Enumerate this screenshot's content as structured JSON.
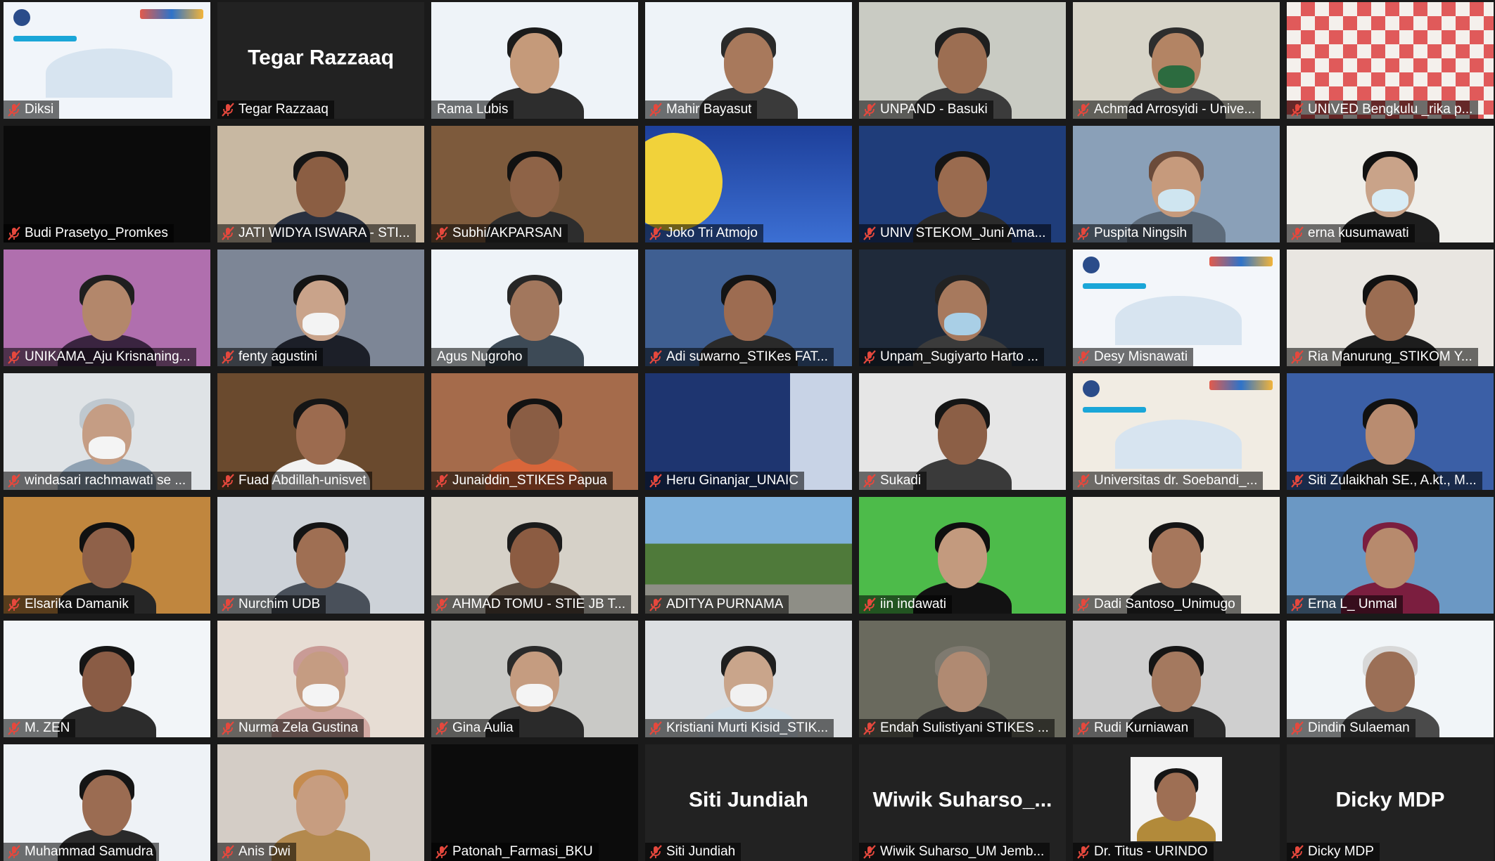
{
  "meeting": {
    "participants": [
      {
        "name": "Diksi",
        "muted": true,
        "view": "banner",
        "bg": "#f1f5fa"
      },
      {
        "name": "Tegar Razzaaq",
        "muted": true,
        "view": "name-only",
        "big_name": "Tegar Razzaaq",
        "bg": "#222222"
      },
      {
        "name": "Rama Lubis",
        "muted": false,
        "view": "camera",
        "active_speaker": true,
        "bg": "#eef3f8",
        "skin": "#c59a7a",
        "shirt": "#2d2d2d",
        "hair": "#1b1b1b"
      },
      {
        "name": "Mahir Bayasut",
        "muted": true,
        "view": "camera",
        "bg": "#eef3f8",
        "skin": "#a8795c",
        "shirt": "#3a3a3a",
        "hair": "#2a2a2a"
      },
      {
        "name": "UNPAND - Basuki",
        "muted": true,
        "view": "camera",
        "bg": "#c9cbc3",
        "skin": "#9c6e52",
        "shirt": "#3b3b3b",
        "hair": "#1f1f1f"
      },
      {
        "name": "Achmad Arrosyidi - Unive...",
        "muted": true,
        "view": "camera",
        "bg": "#d7d4c8",
        "skin": "#b38464",
        "shirt": "#4b4b4b",
        "hair": "#2d2d2d",
        "mask": "#2c6b3f"
      },
      {
        "name": "UNIVED Bengkulu _rika p...",
        "muted": true,
        "view": "pattern",
        "bg": "#f2f2f2"
      },
      {
        "name": "Budi Prasetyo_Promkes",
        "muted": true,
        "view": "dark",
        "bg": "#0b0b0b"
      },
      {
        "name": "JATI WIDYA ISWARA - STI...",
        "muted": true,
        "view": "camera",
        "bg": "#c8b8a2",
        "skin": "#8b5e43",
        "shirt": "#2a3140",
        "hair": "#151515"
      },
      {
        "name": "Subhi/AKPARSAN",
        "muted": true,
        "view": "camera",
        "bg": "#7d5a3c",
        "skin": "#8e6347",
        "shirt": "#2d2d2d",
        "hair": "#111111"
      },
      {
        "name": "Joko Tri Atmojo",
        "muted": true,
        "view": "poster",
        "bg": "#2b59b5"
      },
      {
        "name": "UNIV STEKOM_Juni Ama...",
        "muted": true,
        "view": "camera",
        "bg": "#1f3d7a",
        "skin": "#9a6b4f",
        "shirt": "#2b2b2b",
        "hair": "#151515"
      },
      {
        "name": "Puspita Ningsih",
        "muted": true,
        "view": "camera",
        "bg": "#8aa0b8",
        "skin": "#c69a7c",
        "shirt": "#5d6b7a",
        "hair": "#6b4b3a",
        "mask": "#cfe5f0"
      },
      {
        "name": "erna kusumawati",
        "muted": true,
        "view": "camera",
        "bg": "#efeeea",
        "skin": "#c9a389",
        "shirt": "#1d1d1d",
        "hair": "#111111",
        "mask": "#d9ecf5"
      },
      {
        "name": "UNIKAMA_Aju Krisnaning...",
        "muted": true,
        "view": "camera",
        "bg": "#b06fae",
        "skin": "#b3876b",
        "shirt": "#3a2440",
        "hair": "#1f1f1f"
      },
      {
        "name": "fenty agustini",
        "muted": true,
        "view": "camera",
        "bg": "#7d8696",
        "skin": "#c9a38a",
        "shirt": "#1c1f28",
        "hair": "#141414",
        "mask": "#f3f3f3"
      },
      {
        "name": "Agus Nugroho",
        "muted": false,
        "view": "camera",
        "bg": "#eef3f8",
        "skin": "#a2775d",
        "shirt": "#3d4a56",
        "hair": "#262626"
      },
      {
        "name": "Adi suwarno_STIKes FAT...",
        "muted": true,
        "view": "camera",
        "bg": "#3f5f92",
        "skin": "#9d6c51",
        "shirt": "#2a2a2a",
        "hair": "#141414"
      },
      {
        "name": "Unpam_Sugiyarto Harto ...",
        "muted": true,
        "view": "camera",
        "bg": "#1f2a3a",
        "skin": "#a7795d",
        "shirt": "#3b3b3b",
        "hair": "#222222",
        "mask": "#a9cfe6"
      },
      {
        "name": "Desy Misnawati",
        "muted": true,
        "view": "banner2",
        "bg": "#f3f6fa"
      },
      {
        "name": "Ria Manurung_STIKOM Y...",
        "muted": true,
        "view": "camera",
        "bg": "#e9e6e1",
        "skin": "#9b6d52",
        "shirt": "#1d1d1d",
        "hair": "#111111"
      },
      {
        "name": "windasari rachmawati se ...",
        "muted": true,
        "view": "camera",
        "bg": "#dfe3e6",
        "skin": "#c59d84",
        "shirt": "#8fa1b2",
        "hair": "#bfc8cf",
        "mask": "#f4f4f4"
      },
      {
        "name": "Fuad Abdillah-unisvet",
        "muted": true,
        "view": "camera",
        "bg": "#6a4a2e",
        "skin": "#9c6b4f",
        "shirt": "#f2f2f2",
        "hair": "#151515"
      },
      {
        "name": "Junaiddin_STIKES Papua",
        "muted": true,
        "view": "camera",
        "bg": "#a56b4b",
        "skin": "#8a5d44",
        "shirt": "#d9663a",
        "hair": "#121212"
      },
      {
        "name": "Heru Ginanjar_UNAIC",
        "muted": true,
        "view": "poster2",
        "bg": "#233b7a"
      },
      {
        "name": "Sukadi",
        "muted": true,
        "view": "camera",
        "bg": "#e6e6e6",
        "skin": "#8c5f46",
        "shirt": "#3a3a3a",
        "hair": "#151515"
      },
      {
        "name": "Universitas dr. Soebandi_...",
        "muted": true,
        "view": "banner3",
        "bg": "#f1ece3"
      },
      {
        "name": "Siti Zulaikhah SE., A.kt., M...",
        "muted": true,
        "view": "camera",
        "bg": "#3b5fa6",
        "skin": "#b98c70",
        "shirt": "#1f1f1f",
        "hair": "#111111"
      },
      {
        "name": "Elsarika Damanik",
        "muted": true,
        "view": "camera",
        "bg": "#c0863e",
        "skin": "#8f6149",
        "shirt": "#262626",
        "hair": "#111111"
      },
      {
        "name": "Nurchim UDB",
        "muted": true,
        "view": "camera",
        "bg": "#cdd2d8",
        "skin": "#9f6f53",
        "shirt": "#49505a",
        "hair": "#141414"
      },
      {
        "name": "AHMAD TOMU - STIE JB T...",
        "muted": true,
        "view": "camera",
        "bg": "#d6d1c8",
        "skin": "#8c5c42",
        "shirt": "#57483c",
        "hair": "#1b1b1b"
      },
      {
        "name": "ADITYA PURNAMA",
        "muted": true,
        "view": "landscape",
        "bg": "#6ea0c9"
      },
      {
        "name": "iin indawati",
        "muted": true,
        "view": "camera",
        "bg": "#4dbb4a",
        "skin": "#c39a7e",
        "shirt": "#121212",
        "hair": "#0f0f0f"
      },
      {
        "name": "Dadi Santoso_Unimugo",
        "muted": true,
        "view": "camera",
        "bg": "#ece9e1",
        "skin": "#a6775c",
        "shirt": "#2a2a2a",
        "hair": "#151515"
      },
      {
        "name": "Erna L_ Unmal",
        "muted": true,
        "view": "camera",
        "bg": "#6b98c4",
        "skin": "#b78a6d",
        "shirt": "#7b1e3f",
        "hair": "#7b1e3f"
      },
      {
        "name": "M. ZEN",
        "muted": true,
        "view": "camera",
        "bg": "#f2f5f8",
        "skin": "#8a5c45",
        "shirt": "#2c2c2c",
        "hair": "#151515"
      },
      {
        "name": "Nurma Zela Gustina",
        "muted": true,
        "view": "camera",
        "bg": "#e7ddd4",
        "skin": "#c59c82",
        "shirt": "#d2a9a3",
        "hair": "#c99b96",
        "mask": "#f4f4f4"
      },
      {
        "name": "Gina Aulia",
        "muted": true,
        "view": "camera",
        "bg": "#c9c9c6",
        "skin": "#c59c80",
        "shirt": "#2a2a2a",
        "hair": "#2a2a2a",
        "mask": "#f4f4f4"
      },
      {
        "name": "Kristiani Murti Kisid_STIK...",
        "muted": true,
        "view": "camera",
        "bg": "#dcdfe2",
        "skin": "#c9a58b",
        "shirt": "#d4e1ea",
        "hair": "#1f1f1f",
        "mask": "#f1f1f1"
      },
      {
        "name": "Endah Sulistiyani STIKES ...",
        "muted": true,
        "view": "camera",
        "bg": "#6a6a5e",
        "skin": "#b08a72",
        "shirt": "#2b2b2b",
        "hair": "#7f7a70"
      },
      {
        "name": "Rudi Kurniawan",
        "muted": true,
        "view": "camera",
        "bg": "#cfcfcf",
        "skin": "#a4795f",
        "shirt": "#2a2a2a",
        "hair": "#151515"
      },
      {
        "name": "Dindin Sulaeman",
        "muted": true,
        "view": "camera",
        "bg": "#f1f5f8",
        "skin": "#9b6f56",
        "shirt": "#4a4a4a",
        "hair": "#d8d8d8"
      },
      {
        "name": "Muhammad Samudra",
        "muted": true,
        "view": "camera",
        "bg": "#eef2f6",
        "skin": "#9b6c52",
        "shirt": "#2a2a2a",
        "hair": "#151515"
      },
      {
        "name": "Anis Dwi",
        "muted": true,
        "view": "camera",
        "bg": "#d4cdc6",
        "skin": "#c79d80",
        "shirt": "#b3894d",
        "hair": "#c58b4e"
      },
      {
        "name": "Patonah_Farmasi_BKU",
        "muted": true,
        "view": "dark",
        "bg": "#0c0c0c"
      },
      {
        "name": "Siti Jundiah",
        "muted": true,
        "view": "name-only",
        "big_name": "Siti Jundiah",
        "bg": "#222222"
      },
      {
        "name": "Wiwik Suharso_UM Jemb...",
        "muted": true,
        "view": "name-only",
        "big_name": "Wiwik  Suharso_...",
        "bg": "#222222"
      },
      {
        "name": "Dr. Titus - URINDO",
        "muted": true,
        "view": "photo",
        "bg": "#222222",
        "skin": "#9e6f54",
        "shirt": "#b28a3a",
        "hair": "#151515"
      },
      {
        "name": "Dicky MDP",
        "muted": true,
        "view": "name-only",
        "big_name": "Dicky MDP",
        "bg": "#222222"
      }
    ]
  },
  "icons": {
    "muted_mic": "mic-muted-icon",
    "unmuted_mic": "mic-icon"
  },
  "colors": {
    "active_speaker_border": "#cfe95a",
    "muted_icon": "#e5483d",
    "grid_bg": "#1a1a1a"
  }
}
